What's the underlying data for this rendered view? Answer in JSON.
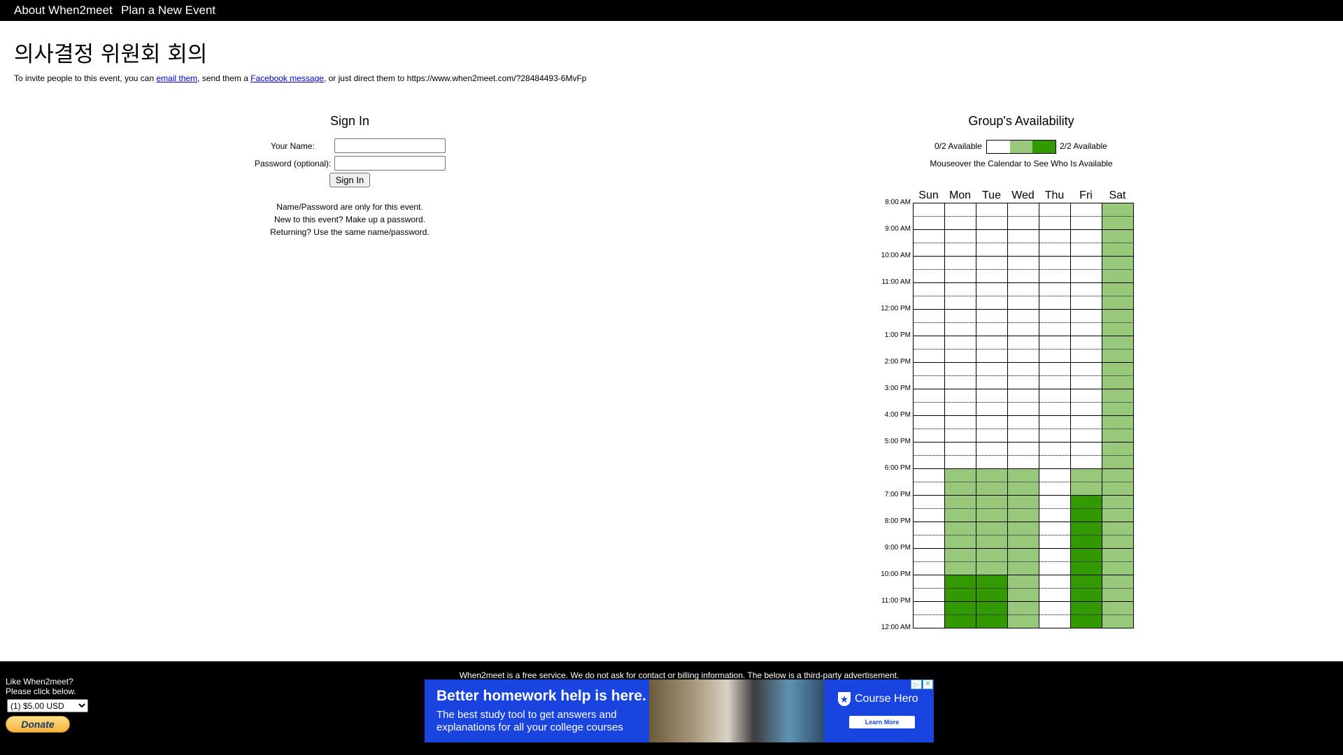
{
  "nav": {
    "about": "About When2meet",
    "plan": "Plan a New Event"
  },
  "event": {
    "title": "의사결정 위원회 회의",
    "invite_prefix": "To invite people to this event, you can ",
    "email_link": "email them",
    "invite_mid": ", send them a ",
    "facebook_link": "Facebook message",
    "invite_suffix": ", or just direct them to https://www.when2meet.com/?28484493-6MvFp"
  },
  "signin": {
    "heading": "Sign In",
    "name_label": "Your Name:",
    "name_value": "",
    "password_label": "Password (optional):",
    "password_value": "",
    "button": "Sign In",
    "notes": [
      "Name/Password are only for this event.",
      "New to this event? Make up a password.",
      "Returning? Use the same name/password."
    ]
  },
  "availability": {
    "heading": "Group's Availability",
    "legend_min": "0/2 Available",
    "legend_max": "2/2 Available",
    "legend_colors": [
      "#ffffff",
      "#98c97a",
      "#339900"
    ],
    "mouseover_text": "Mouseover the Calendar to See Who Is Available",
    "days": [
      "Sun",
      "Mon",
      "Tue",
      "Wed",
      "Thu",
      "Fri",
      "Sat"
    ],
    "times": [
      "8:00 AM",
      "9:00 AM",
      "10:00 AM",
      "11:00 AM",
      "12:00 PM",
      "1:00 PM",
      "2:00 PM",
      "3:00 PM",
      "4:00 PM",
      "5:00 PM",
      "6:00 PM",
      "7:00 PM",
      "8:00 PM",
      "9:00 PM",
      "10:00 PM",
      "11:00 PM",
      "12:00 AM"
    ],
    "slots_per_hour": 2,
    "counts_by_day": [
      [
        0,
        0,
        0,
        0,
        0,
        0,
        0,
        0,
        0,
        0,
        0,
        0,
        0,
        0,
        0,
        0,
        0,
        0,
        0,
        0,
        0,
        0,
        0,
        0,
        0,
        0,
        0,
        0,
        0,
        0,
        0,
        0
      ],
      [
        0,
        0,
        0,
        0,
        0,
        0,
        0,
        0,
        0,
        0,
        0,
        0,
        0,
        0,
        0,
        0,
        0,
        0,
        0,
        0,
        1,
        1,
        1,
        1,
        1,
        1,
        1,
        1,
        2,
        2,
        2,
        2
      ],
      [
        0,
        0,
        0,
        0,
        0,
        0,
        0,
        0,
        0,
        0,
        0,
        0,
        0,
        0,
        0,
        0,
        0,
        0,
        0,
        0,
        1,
        1,
        1,
        1,
        1,
        1,
        1,
        1,
        2,
        2,
        2,
        2
      ],
      [
        0,
        0,
        0,
        0,
        0,
        0,
        0,
        0,
        0,
        0,
        0,
        0,
        0,
        0,
        0,
        0,
        0,
        0,
        0,
        0,
        1,
        1,
        1,
        1,
        1,
        1,
        1,
        1,
        1,
        1,
        1,
        1
      ],
      [
        0,
        0,
        0,
        0,
        0,
        0,
        0,
        0,
        0,
        0,
        0,
        0,
        0,
        0,
        0,
        0,
        0,
        0,
        0,
        0,
        0,
        0,
        0,
        0,
        0,
        0,
        0,
        0,
        0,
        0,
        0,
        0
      ],
      [
        0,
        0,
        0,
        0,
        0,
        0,
        0,
        0,
        0,
        0,
        0,
        0,
        0,
        0,
        0,
        0,
        0,
        0,
        0,
        0,
        1,
        1,
        2,
        2,
        2,
        2,
        2,
        2,
        2,
        2,
        2,
        2
      ],
      [
        1,
        1,
        1,
        1,
        1,
        1,
        1,
        1,
        1,
        1,
        1,
        1,
        1,
        1,
        1,
        1,
        1,
        1,
        1,
        1,
        1,
        1,
        1,
        1,
        1,
        1,
        1,
        1,
        1,
        1,
        1,
        1
      ]
    ]
  },
  "footer": {
    "free_note": "When2meet is a free service. We do not ask for contact or billing information. The below is a third-party advertisement.",
    "like_line1": "Like When2meet?",
    "like_line2": "Please click below.",
    "donate_select": "(1) $5.00 USD",
    "donate_button": "Donate"
  },
  "ad": {
    "headline": "Better homework help is here.",
    "body": "The best study tool to get answers and explanations for all your college courses",
    "brand": "Course Hero",
    "cta": "Learn More",
    "choices_icon": "ad-choices-icon",
    "close_icon": "close-icon"
  }
}
